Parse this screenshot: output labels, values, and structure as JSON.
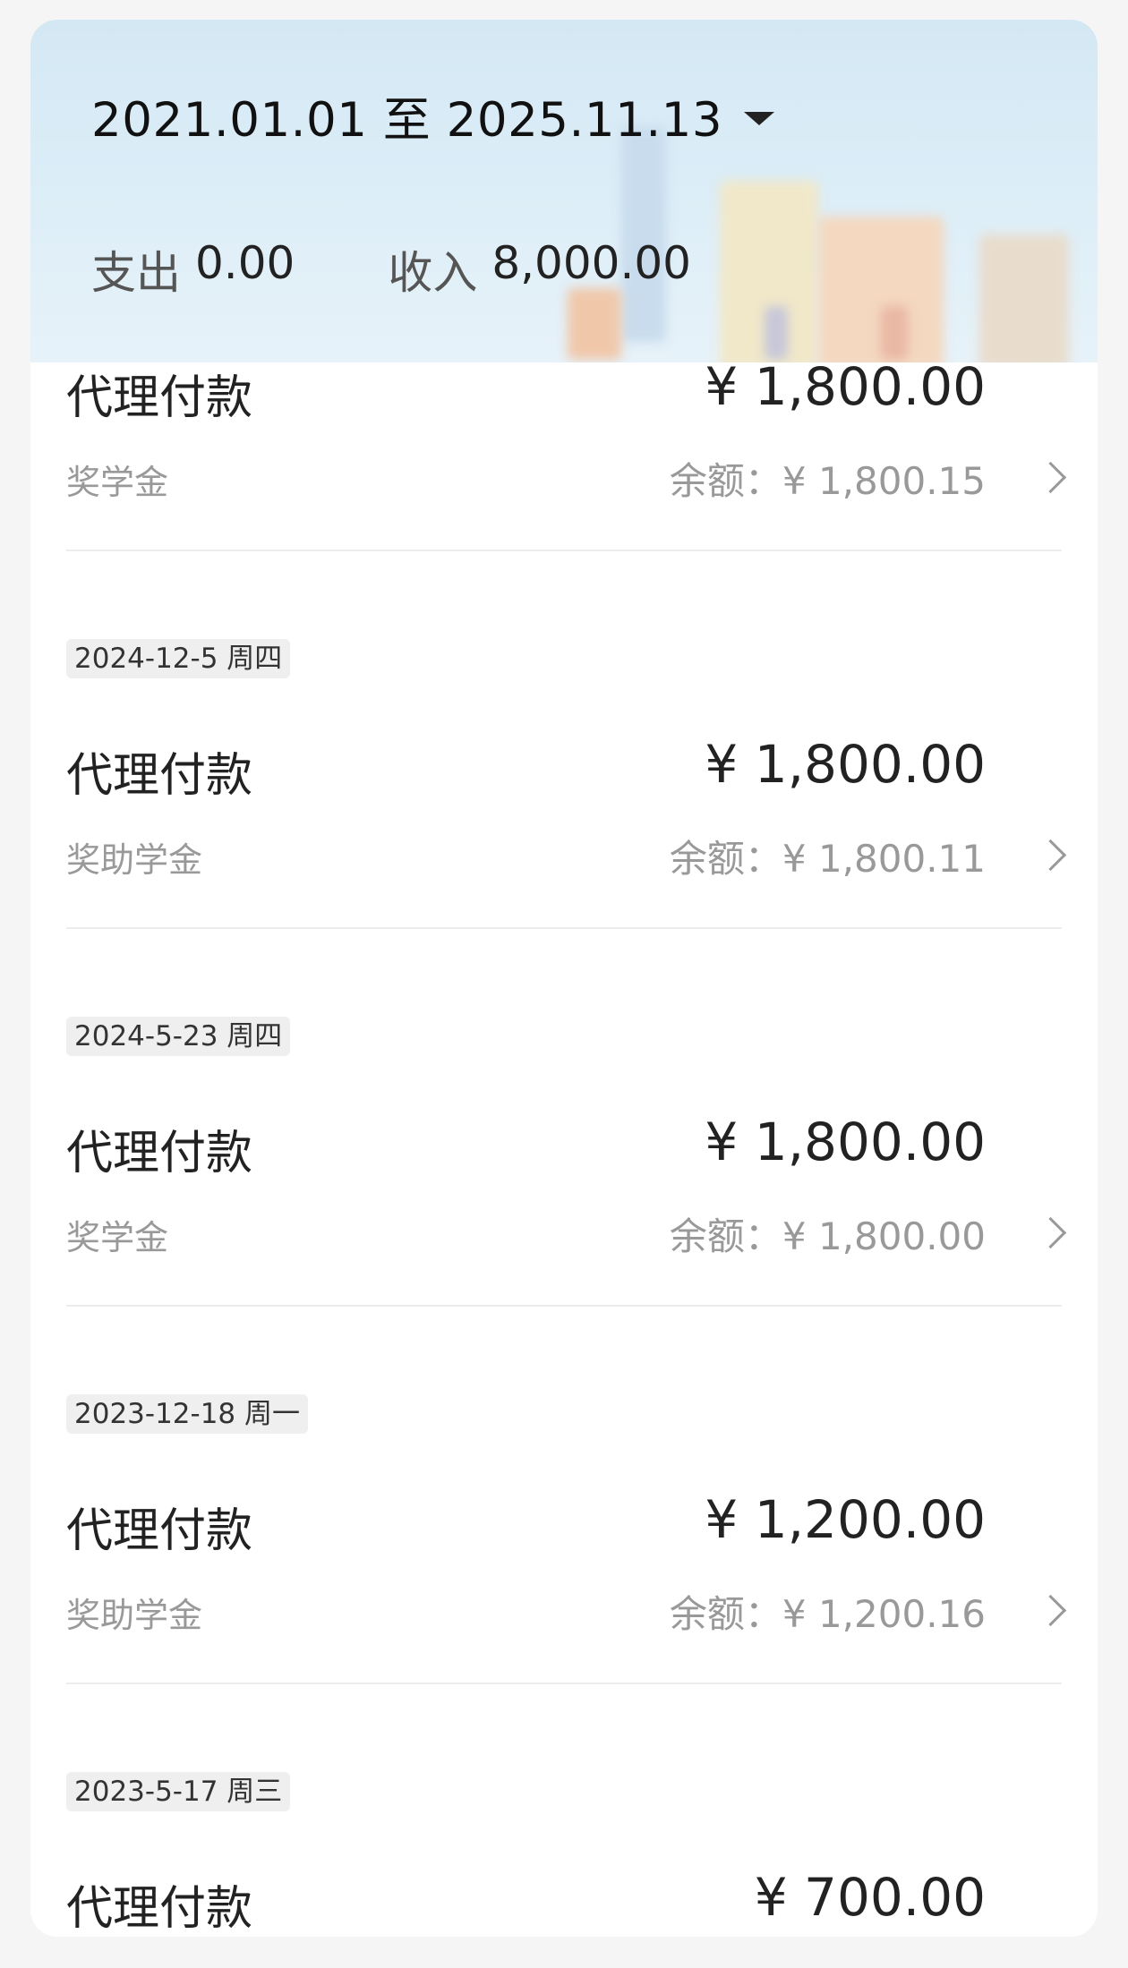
{
  "header": {
    "date_range": "2021.01.01 至 2025.11.13",
    "expense_label": "支出",
    "expense_value": "0.00",
    "income_label": "收入",
    "income_value": "8,000.00"
  },
  "entries": [
    {
      "date": "",
      "title": "代理付款",
      "amount": "¥ 1,800.00",
      "category": "奖学金",
      "balance": "余额：¥ 1,800.15"
    },
    {
      "date": "2024-12-5 周四",
      "title": "代理付款",
      "amount": "¥ 1,800.00",
      "category": "奖助学金",
      "balance": "余额：¥ 1,800.11"
    },
    {
      "date": "2024-5-23 周四",
      "title": "代理付款",
      "amount": "¥ 1,800.00",
      "category": "奖学金",
      "balance": "余额：¥ 1,800.00"
    },
    {
      "date": "2023-12-18 周一",
      "title": "代理付款",
      "amount": "¥ 1,200.00",
      "category": "奖助学金",
      "balance": "余额：¥ 1,200.16"
    },
    {
      "date": "2023-5-17 周三",
      "title": "代理付款",
      "amount": "¥ 700.00",
      "category": "",
      "balance": ""
    }
  ]
}
